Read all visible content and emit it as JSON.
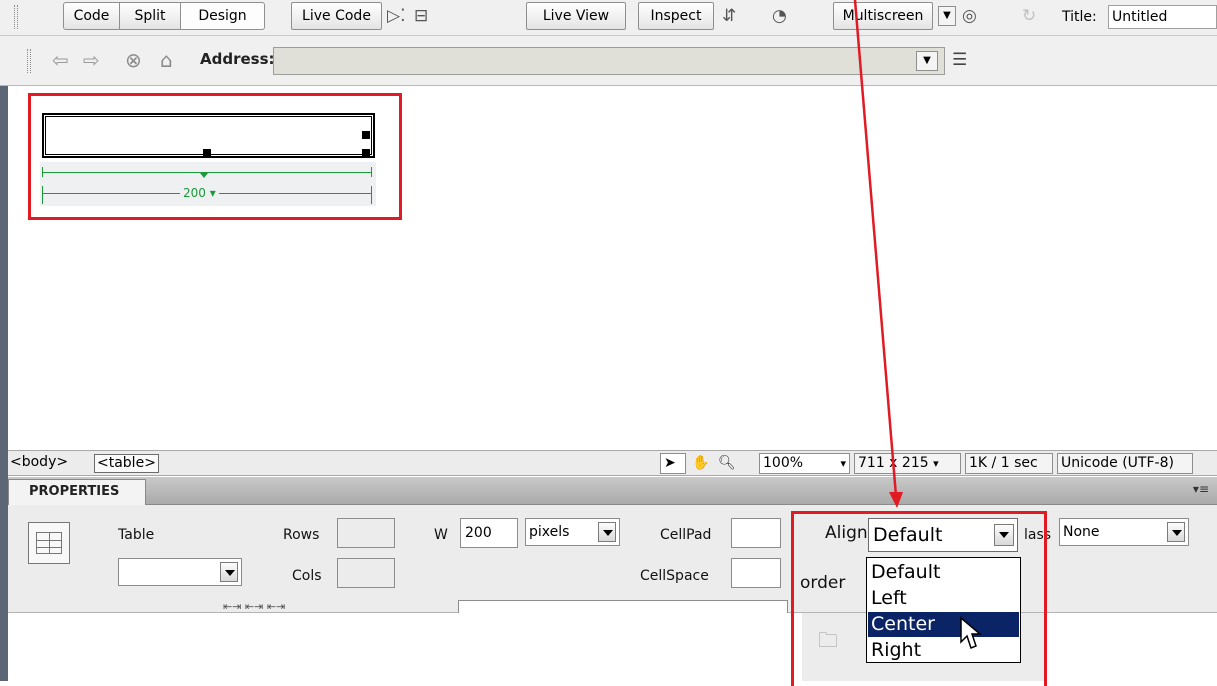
{
  "toolbar": {
    "code": "Code",
    "split": "Split",
    "design": "Design",
    "live_code": "Live Code",
    "live_view": "Live View",
    "inspect": "Inspect",
    "multiscreen": "Multiscreen",
    "title_label": "Title:",
    "title_value": "Untitled"
  },
  "address_bar": {
    "label": "Address:",
    "value": ""
  },
  "canvas": {
    "table_width": "200"
  },
  "status_bar": {
    "tag_body": "<body>",
    "tag_table": "<table>",
    "zoom": "100%",
    "window_size": "711 x 215",
    "download": "1K / 1 sec",
    "encoding": "Unicode (UTF-8)"
  },
  "properties": {
    "tab_label": "PROPERTIES",
    "table_label": "Table",
    "table_id": "",
    "rows_label": "Rows",
    "rows_value": "",
    "cols_label": "Cols",
    "cols_value": "",
    "w_label": "W",
    "w_value": "200",
    "w_unit": "pixels",
    "cellpad_label": "CellPad",
    "cellpad_value": "",
    "cellspace_label": "CellSpace",
    "cellspace_value": "",
    "align_label": "Align",
    "align_value": "Default",
    "border_label": "order",
    "class_label": "lass",
    "class_value": "None",
    "align_options": [
      "Default",
      "Left",
      "Center",
      "Right"
    ],
    "align_highlighted": "Center"
  },
  "colors": {
    "annotation": "#e01b24",
    "guide": "#1b9a3a",
    "selection": "#0a2466"
  }
}
